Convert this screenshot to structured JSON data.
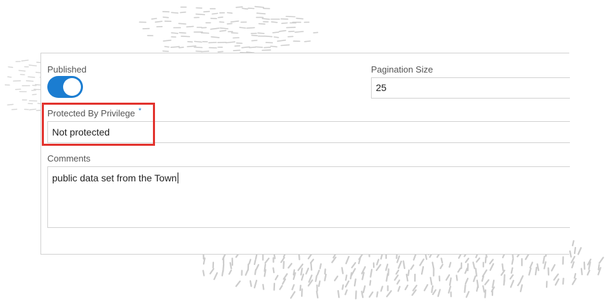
{
  "published": {
    "label": "Published",
    "enabled": true
  },
  "pagination": {
    "label": "Pagination Size",
    "value": "25"
  },
  "protection": {
    "label": "Protected By Privilege",
    "required_marker": "*",
    "value": "Not protected"
  },
  "comments": {
    "label": "Comments",
    "value": "public data set from the Town"
  },
  "colors": {
    "toggle_on": "#1b7dd1",
    "highlight": "#e2332e",
    "required_marker": "#1b7dd1"
  }
}
